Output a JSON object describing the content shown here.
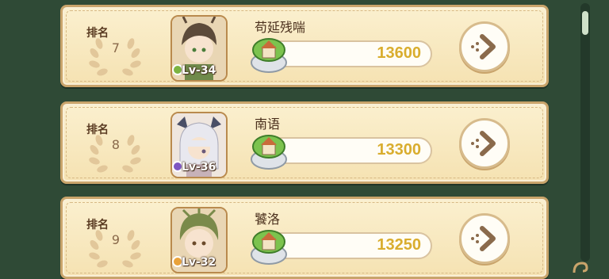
{
  "ranking": {
    "rank_label": "排名",
    "entries": [
      {
        "rank": "7",
        "name": "苟延残喘",
        "level": "Lv-34",
        "score": "13600",
        "avatar_hair": "#5c4a3a",
        "badge_color": "#7cb342"
      },
      {
        "rank": "8",
        "name": "南语",
        "level": "Lv-36",
        "score": "13300",
        "avatar_hair": "#e8e8ef",
        "badge_color": "#7e57c2"
      },
      {
        "rank": "9",
        "name": "饕洛",
        "level": "Lv-32",
        "score": "13250",
        "avatar_hair": "#7a8a4a",
        "badge_color": "#e9a23b"
      }
    ]
  },
  "icons": {
    "laurel": "laurel-wreath-icon",
    "guild": "guild-house-icon",
    "go": "arrow-right-icon"
  },
  "colors": {
    "background": "#2f4a36",
    "card": "#f5e2b2",
    "score_text": "#d9ad2e"
  }
}
